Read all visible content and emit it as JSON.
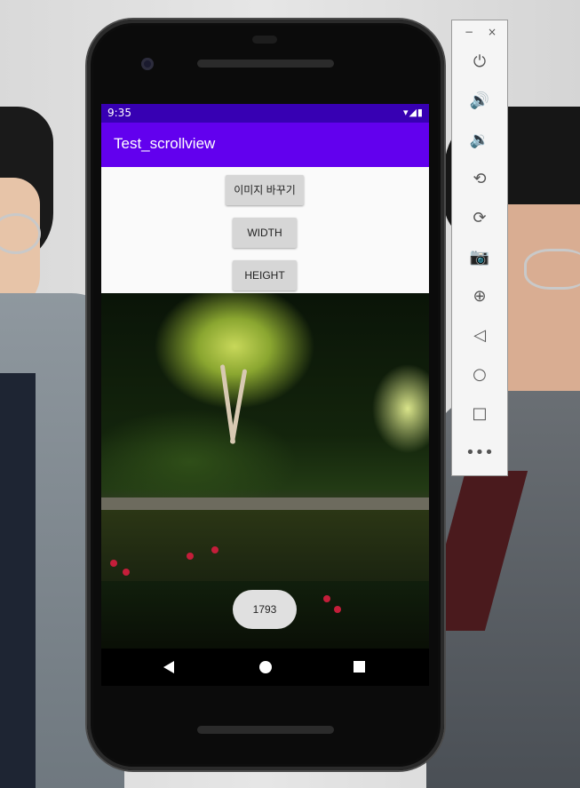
{
  "statusbar": {
    "time": "9:35",
    "icons": "▾◢▮"
  },
  "app": {
    "title": "Test_scrollview"
  },
  "buttons": {
    "change_image": "이미지 바꾸기",
    "width": "WIDTH",
    "height": "HEIGHT"
  },
  "toast": {
    "text": "1793"
  },
  "emulator_toolbar": {
    "minimize": "−",
    "close": "×",
    "icons": [
      "power-icon",
      "volume-up-icon",
      "volume-down-icon",
      "rotate-left-icon",
      "rotate-right-icon",
      "camera-icon",
      "zoom-icon",
      "back-icon",
      "home-icon",
      "overview-icon",
      "more-icon"
    ]
  }
}
